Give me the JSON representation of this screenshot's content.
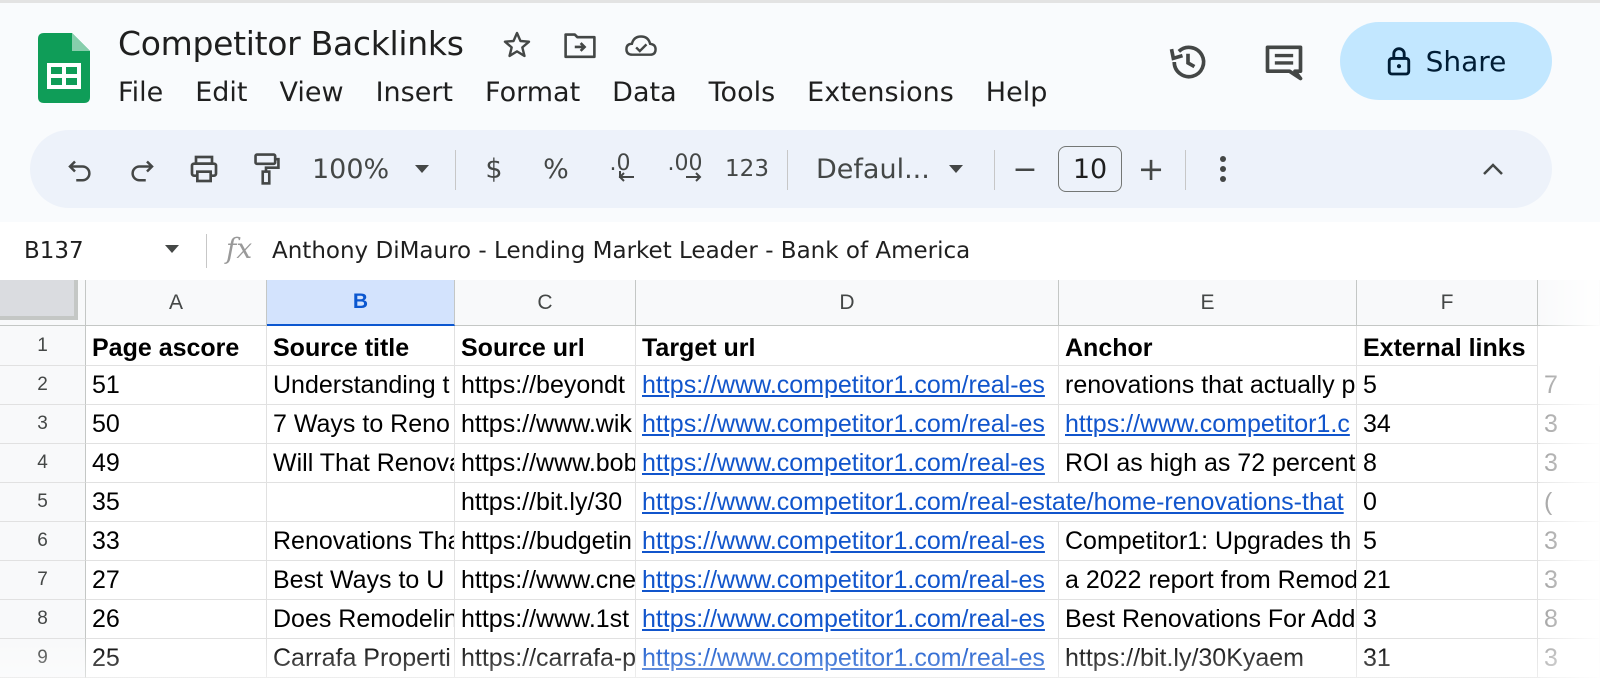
{
  "document": {
    "title": "Competitor Backlinks"
  },
  "menu": [
    "File",
    "Edit",
    "View",
    "Insert",
    "Format",
    "Data",
    "Tools",
    "Extensions",
    "Help"
  ],
  "header": {
    "share_label": "Share"
  },
  "toolbar": {
    "zoom": "100%",
    "currency": "$",
    "percent": "%",
    "decrease_decimal": ".0",
    "increase_decimal": ".00",
    "number_format": "123",
    "font": "Defaul...",
    "font_size": "10",
    "minus": "−",
    "plus": "+"
  },
  "formula_bar": {
    "cell_ref": "B137",
    "fx": "fx",
    "content": "Anthony DiMauro - Lending Market Leader - Bank of America"
  },
  "sheet": {
    "selected_column": "B",
    "columns": [
      "A",
      "B",
      "C",
      "D",
      "E",
      "F"
    ],
    "row_numbers": [
      "1",
      "2",
      "3",
      "4",
      "5",
      "6",
      "7",
      "8",
      "9"
    ],
    "rows": [
      [
        "Page ascore",
        "Source title",
        "Source url",
        "Target url",
        "Anchor",
        "External links"
      ],
      [
        "51",
        "Understanding t",
        "https://beyondt",
        "https://www.competitor1.com/real-es",
        "renovations that actually p",
        "5"
      ],
      [
        "50",
        "7 Ways to Reno",
        "https://www.wik",
        "https://www.competitor1.com/real-es",
        "https://www.competitor1.c",
        "34"
      ],
      [
        "49",
        "Will That Renova",
        "https://www.bob",
        "https://www.competitor1.com/real-es",
        "ROI as high as 72 percent",
        "8"
      ],
      [
        "35",
        "",
        "https://bit.ly/30",
        "https://www.competitor1.com/real-estate/home-renovations-that",
        "",
        "0"
      ],
      [
        "33",
        "Renovations Tha",
        "https://budgetin",
        "https://www.competitor1.com/real-es",
        "Competitor1: Upgrades th",
        "5"
      ],
      [
        "27",
        "Best Ways to U",
        "https://www.cne",
        "https://www.competitor1.com/real-es",
        "a 2022 report from Remod",
        "21"
      ],
      [
        "26",
        "Does Remodelin",
        "https://www.1st",
        "https://www.competitor1.com/real-es",
        "Best Renovations For Add",
        "3"
      ],
      [
        "25",
        "Carrafa Properti",
        "https://carrafa-p",
        "https://www.competitor1.com/real-es",
        "https://bit.ly/30Kyaem",
        "31"
      ]
    ],
    "link_cells": [
      "3-1",
      "3-2",
      "3-3",
      "3-4",
      "3-5",
      "3-6",
      "3-7",
      "3-8",
      "4-2"
    ],
    "next_column_peek": [
      "7",
      "3",
      "3",
      "(",
      "3",
      "3",
      "8",
      "3"
    ]
  }
}
